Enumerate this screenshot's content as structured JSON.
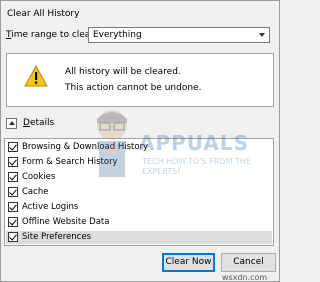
{
  "window": {
    "title": "Clear All History"
  },
  "time_range": {
    "label_prefix": "T",
    "label_rest": "ime range to clear:",
    "selected": "Everything"
  },
  "warning": {
    "line1": "All history will be cleared.",
    "line2": "This action cannot be undone."
  },
  "details": {
    "label_first": "D",
    "label_rest": "etails"
  },
  "items": [
    {
      "label": "Browsing & Download History",
      "checked": true
    },
    {
      "label": "Form & Search History",
      "checked": true
    },
    {
      "label": "Cookies",
      "checked": true
    },
    {
      "label": "Cache",
      "checked": true
    },
    {
      "label": "Active Logins",
      "checked": true
    },
    {
      "label": "Offline Website Data",
      "checked": true
    },
    {
      "label": "Site Preferences",
      "checked": true
    }
  ],
  "buttons": {
    "clear_now": "Clear Now",
    "cancel": "Cancel"
  },
  "watermark": {
    "brand": "APPUALS",
    "tagline": "TECH HOW-TO'S FROM THE EXPERTS!"
  },
  "footer_mark": "wsxdn.com",
  "colors": {
    "accent": "#0078d7",
    "warning_yellow": "#f5c518"
  }
}
